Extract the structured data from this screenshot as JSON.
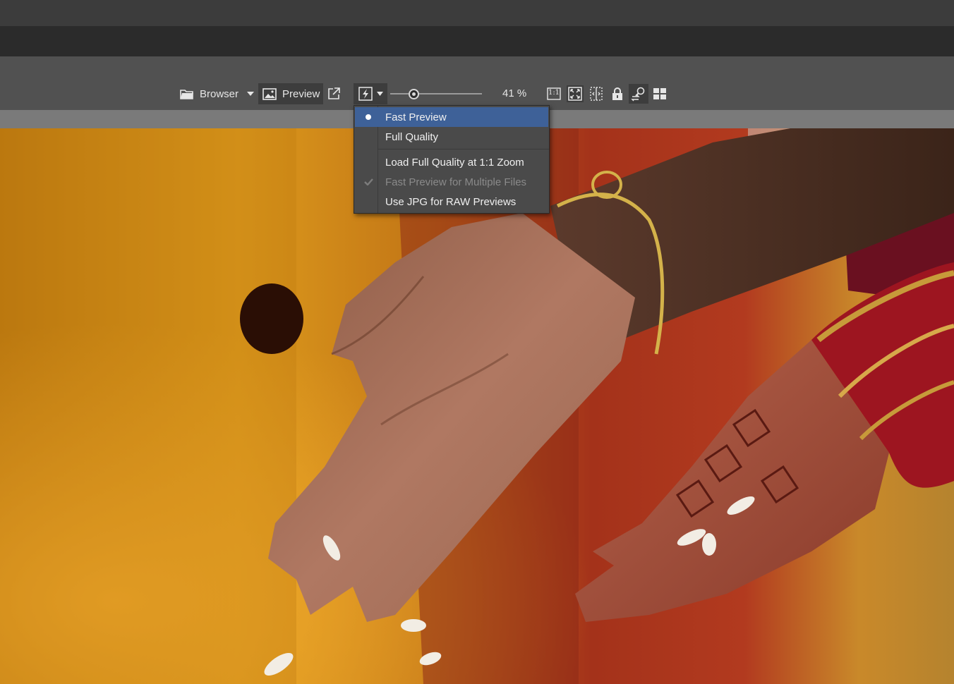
{
  "toolbar": {
    "browser_label": "Browser",
    "preview_label": "Preview",
    "zoom_text": "41 %",
    "zoom_level": 0.25,
    "one_to_one_label": "1:1"
  },
  "icons": {
    "browser": "folder-icon",
    "preview": "image-icon",
    "open_external": "open-external-icon",
    "preview_quality": "lightning-icon",
    "fit": "fit-to-window-icon",
    "compare": "compare-icon",
    "lock": "lock-icon",
    "sync_zoom": "sync-zoom-icon",
    "layout": "grid-layout-icon"
  },
  "quality_menu": {
    "items": [
      {
        "label": "Fast Preview",
        "selected": true,
        "mark": "dot"
      },
      {
        "label": "Full Quality"
      },
      {
        "label": "Load Full Quality at 1:1 Zoom"
      },
      {
        "label": "Fast Preview for Multiple Files",
        "disabled": true,
        "mark": "check"
      },
      {
        "label": "Use JPG for RAW Previews"
      }
    ]
  },
  "colors": {
    "selected": "#3e6198",
    "toolbar": "#515151"
  }
}
